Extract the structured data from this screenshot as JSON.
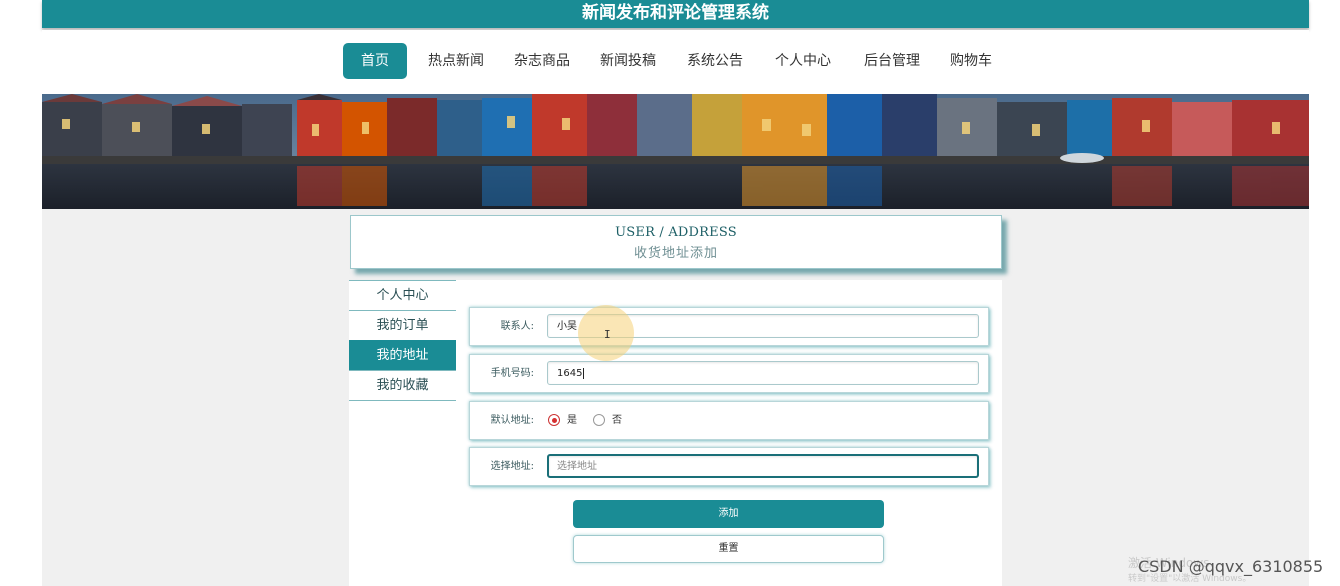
{
  "header": {
    "title": "新闻发布和评论管理系统"
  },
  "nav": {
    "items": [
      {
        "label": "首页",
        "active": true
      },
      {
        "label": "热点新闻"
      },
      {
        "label": "杂志商品"
      },
      {
        "label": "新闻投稿"
      },
      {
        "label": "系统公告"
      },
      {
        "label": "个人中心"
      },
      {
        "label": "后台管理"
      },
      {
        "label": "购物车"
      }
    ]
  },
  "section": {
    "title_en": "USER / ADDRESS",
    "title_cn": "收货地址添加"
  },
  "side_menu": {
    "items": [
      {
        "label": "个人中心"
      },
      {
        "label": "我的订单"
      },
      {
        "label": "我的地址",
        "active": true
      },
      {
        "label": "我的收藏"
      }
    ]
  },
  "form": {
    "contact": {
      "label": "联系人:",
      "value": "小吴"
    },
    "phone": {
      "label": "手机号码:",
      "value": "1645"
    },
    "default_address": {
      "label": "默认地址:",
      "yes": "是",
      "no": "否",
      "selected": "是"
    },
    "address": {
      "label": "选择地址:",
      "placeholder": "选择地址"
    }
  },
  "buttons": {
    "add": "添加",
    "reset": "重置"
  },
  "overlay": {
    "watermark": "CSDN @qqvx_6310855",
    "activate_title": "激活 Windows",
    "activate_sub": "转到\"设置\"以激活 Windows。"
  },
  "colors": {
    "primary": "#1a8c95",
    "radio_checked": "#d63030"
  }
}
